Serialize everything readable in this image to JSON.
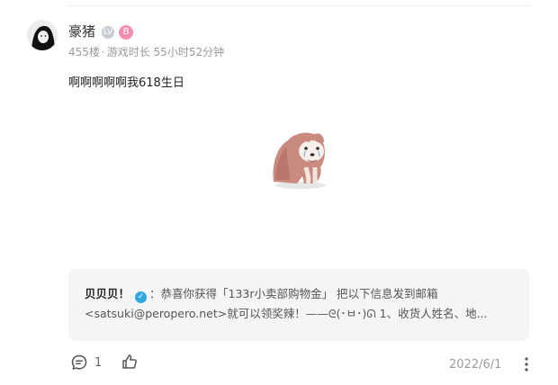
{
  "user": {
    "name": "豪猪",
    "badge_level": "LV",
    "badge_pink": "B",
    "floor": "455楼",
    "separator": "·",
    "playtime": "游戏时长 55小时52分钟"
  },
  "post": {
    "text": "啊啊啊啊啊我618生日",
    "sticker_icon": "crying-dog-sticker"
  },
  "reply": {
    "author": "贝贝贝！",
    "verified_icon": "verified-check-icon",
    "line1_text": "：恭喜你获得「133r小卖部购物金」 把以下信息发到邮箱",
    "line2_text": "<satsuki@peropero.net>就可以领奖辣！——ᘓ(･ㅂ･)ᘏ 1、收货人姓名、地..."
  },
  "footer": {
    "comment_count": "1",
    "date": "2022/6/1"
  },
  "colors": {
    "verified": "#2fa8e0",
    "pink_badge": "#f48fb1",
    "reply_bg": "#f4f5f7"
  }
}
